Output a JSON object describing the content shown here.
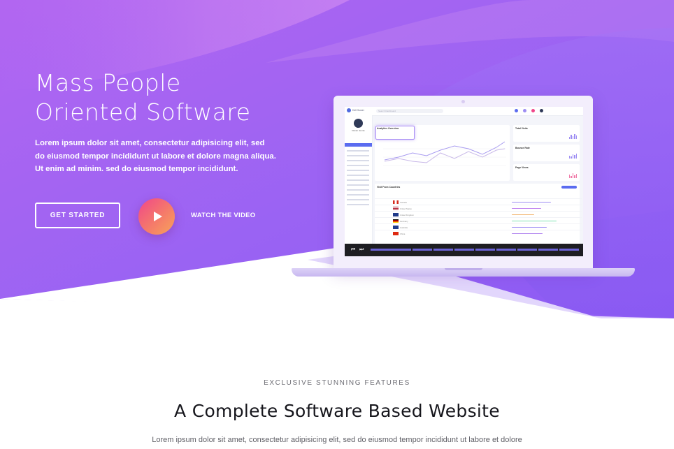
{
  "hero": {
    "title_line1": "Mass People",
    "title_line2": "Oriented Software",
    "text": "Lorem ipsum dolor sit amet, consectetur adipisicing elit, sed do eiusmod tempor incididunt ut labore et dolore magna aliqua. Ut enim ad minim. sed do eiusmod tempor incididunt.",
    "cta_label": "GET STARTED",
    "watch_label": "WATCH THE VIDEO"
  },
  "dashboard": {
    "app_name": "Dell Sower",
    "search_placeholder": "Search Dashboard",
    "user_name": "Danier Jennis",
    "analytics_title": "Analytics Overview",
    "card_titles": [
      "Total Visits",
      "Bounce Rate",
      "Page Views"
    ],
    "table_title": "Visit From Countries",
    "countries": [
      "Canada",
      "United States",
      "United Kingdom",
      "Germany",
      "Australia",
      "China"
    ]
  },
  "features": {
    "subtitle": "EXCLUSIVE STUNNING FEATURES",
    "title": "A Complete Software Based Website",
    "text": "Lorem ipsum dolor sit amet, consectetur adipisicing elit, sed do eiusmod tempor incididunt ut labore et dolore"
  },
  "colors": {
    "hero_start": "#b266f1",
    "hero_end": "#8b5cf6",
    "accent": "#5b6cf0",
    "play_gradient": [
      "#f0468a",
      "#f7a45a"
    ]
  },
  "icons": [
    "play-icon",
    "skip-back-icon",
    "skip-forward-icon",
    "search-icon",
    "bell-icon"
  ]
}
